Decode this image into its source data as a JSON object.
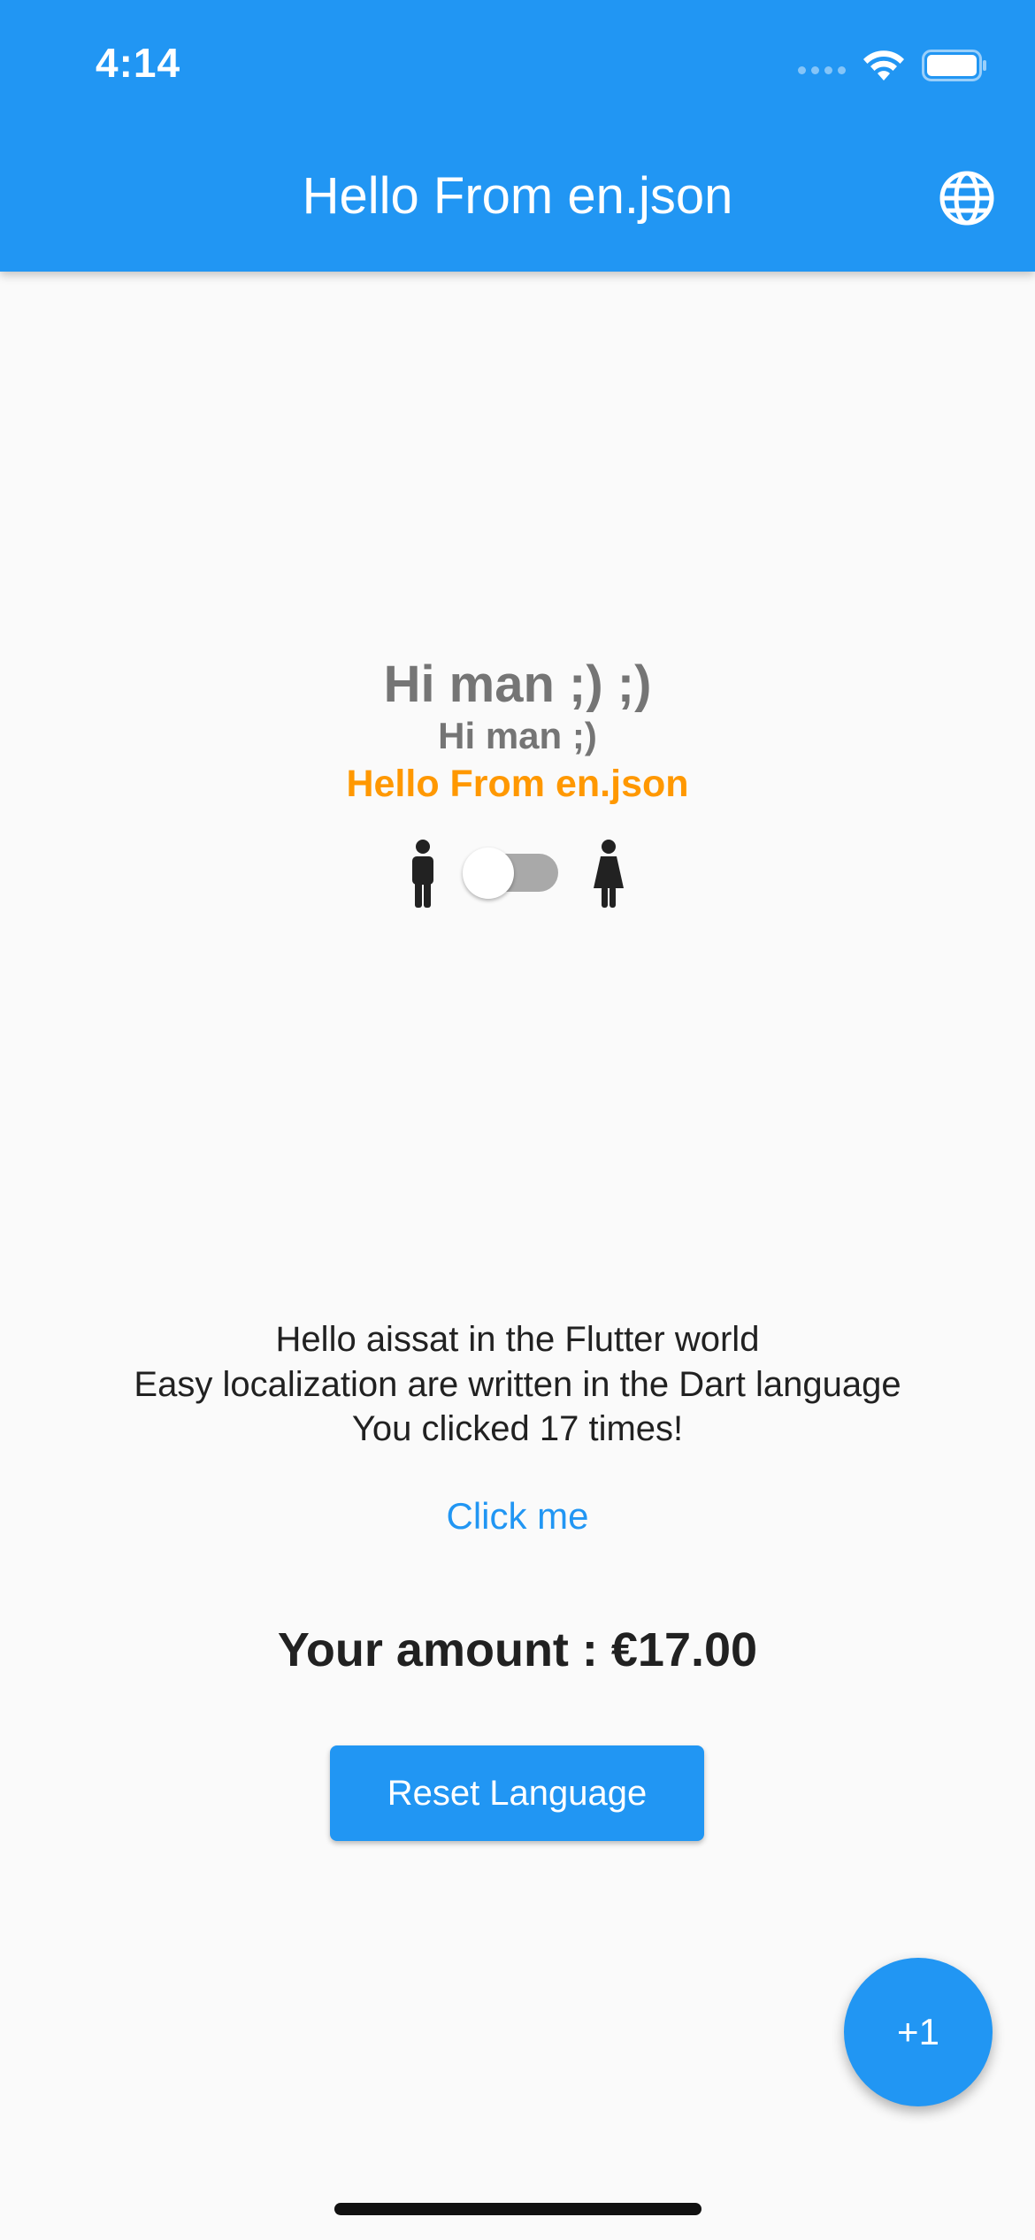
{
  "status_bar": {
    "time": "4:14",
    "wifi_icon": "wifi-icon",
    "battery_icon": "battery-icon"
  },
  "app_bar": {
    "title": "Hello From en.json",
    "language_icon": "globe-icon",
    "background_color": "#2196f3"
  },
  "greetings": {
    "big": "Hi man ;) ;)",
    "small": "Hi man ;)",
    "orange": "Hello From en.json",
    "orange_color": "#ff9800"
  },
  "gender_toggle": {
    "left_icon": "male-icon",
    "right_icon": "female-icon",
    "switch_on": false
  },
  "messages": {
    "line1": "Hello aissat in the Flutter world",
    "line2": "Easy localization are written in the Dart language",
    "line3": "You clicked 17 times!"
  },
  "click_me_label": "Click me",
  "amount_text": "Your amount : €17.00",
  "reset_button_label": "Reset Language",
  "fab_label": "+1"
}
